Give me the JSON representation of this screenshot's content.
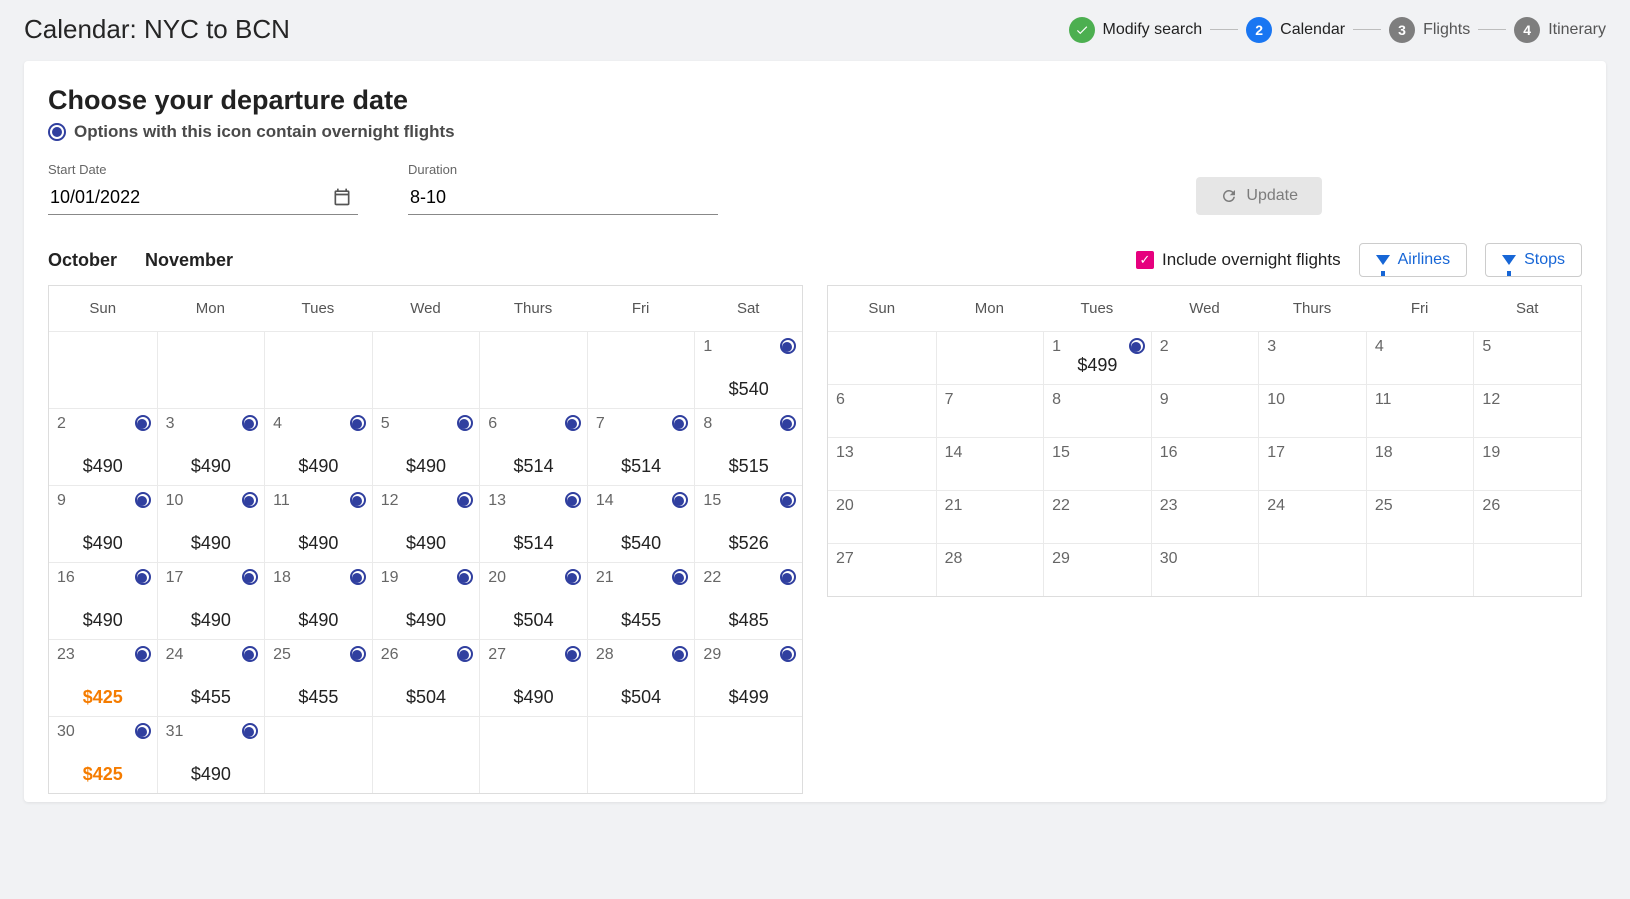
{
  "page_title": "Calendar: NYC to BCN",
  "stepper": {
    "modify": "Modify search",
    "calendar": {
      "num": "2",
      "label": "Calendar"
    },
    "flights": {
      "num": "3",
      "label": "Flights"
    },
    "itinerary": {
      "num": "4",
      "label": "Itinerary"
    }
  },
  "heading": "Choose your departure date",
  "overnight_note": "Options with this icon contain overnight flights",
  "start_date": {
    "label": "Start Date",
    "value": "10/01/2022"
  },
  "duration": {
    "label": "Duration",
    "value": "8-10"
  },
  "update_label": "Update",
  "tabs": {
    "october": "October",
    "november": "November"
  },
  "include_overnight": "Include overnight flights",
  "airlines_label": "Airlines",
  "stops_label": "Stops",
  "weekdays": [
    "Sun",
    "Mon",
    "Tues",
    "Wed",
    "Thurs",
    "Fri",
    "Sat"
  ],
  "october": [
    {
      "d": "",
      "p": "",
      "on": false
    },
    {
      "d": "",
      "p": "",
      "on": false
    },
    {
      "d": "",
      "p": "",
      "on": false
    },
    {
      "d": "",
      "p": "",
      "on": false
    },
    {
      "d": "",
      "p": "",
      "on": false
    },
    {
      "d": "",
      "p": "",
      "on": false
    },
    {
      "d": "1",
      "p": "$540",
      "on": true
    },
    {
      "d": "2",
      "p": "$490",
      "on": true
    },
    {
      "d": "3",
      "p": "$490",
      "on": true
    },
    {
      "d": "4",
      "p": "$490",
      "on": true
    },
    {
      "d": "5",
      "p": "$490",
      "on": true
    },
    {
      "d": "6",
      "p": "$514",
      "on": true
    },
    {
      "d": "7",
      "p": "$514",
      "on": true
    },
    {
      "d": "8",
      "p": "$515",
      "on": true
    },
    {
      "d": "9",
      "p": "$490",
      "on": true
    },
    {
      "d": "10",
      "p": "$490",
      "on": true
    },
    {
      "d": "11",
      "p": "$490",
      "on": true
    },
    {
      "d": "12",
      "p": "$490",
      "on": true
    },
    {
      "d": "13",
      "p": "$514",
      "on": true
    },
    {
      "d": "14",
      "p": "$540",
      "on": true
    },
    {
      "d": "15",
      "p": "$526",
      "on": true
    },
    {
      "d": "16",
      "p": "$490",
      "on": true
    },
    {
      "d": "17",
      "p": "$490",
      "on": true
    },
    {
      "d": "18",
      "p": "$490",
      "on": true
    },
    {
      "d": "19",
      "p": "$490",
      "on": true
    },
    {
      "d": "20",
      "p": "$504",
      "on": true
    },
    {
      "d": "21",
      "p": "$455",
      "on": true
    },
    {
      "d": "22",
      "p": "$485",
      "on": true
    },
    {
      "d": "23",
      "p": "$425",
      "on": true,
      "low": true
    },
    {
      "d": "24",
      "p": "$455",
      "on": true
    },
    {
      "d": "25",
      "p": "$455",
      "on": true
    },
    {
      "d": "26",
      "p": "$504",
      "on": true
    },
    {
      "d": "27",
      "p": "$490",
      "on": true
    },
    {
      "d": "28",
      "p": "$504",
      "on": true
    },
    {
      "d": "29",
      "p": "$499",
      "on": true
    },
    {
      "d": "30",
      "p": "$425",
      "on": true,
      "low": true
    },
    {
      "d": "31",
      "p": "$490",
      "on": true
    },
    {
      "d": "",
      "p": "",
      "on": false
    },
    {
      "d": "",
      "p": "",
      "on": false
    },
    {
      "d": "",
      "p": "",
      "on": false
    },
    {
      "d": "",
      "p": "",
      "on": false
    },
    {
      "d": "",
      "p": "",
      "on": false
    }
  ],
  "november": [
    {
      "d": "",
      "p": "",
      "on": false
    },
    {
      "d": "",
      "p": "",
      "on": false
    },
    {
      "d": "1",
      "p": "$499",
      "on": true
    },
    {
      "d": "2",
      "p": "",
      "on": false
    },
    {
      "d": "3",
      "p": "",
      "on": false
    },
    {
      "d": "4",
      "p": "",
      "on": false
    },
    {
      "d": "5",
      "p": "",
      "on": false
    },
    {
      "d": "6",
      "p": "",
      "on": false
    },
    {
      "d": "7",
      "p": "",
      "on": false
    },
    {
      "d": "8",
      "p": "",
      "on": false
    },
    {
      "d": "9",
      "p": "",
      "on": false
    },
    {
      "d": "10",
      "p": "",
      "on": false
    },
    {
      "d": "11",
      "p": "",
      "on": false
    },
    {
      "d": "12",
      "p": "",
      "on": false
    },
    {
      "d": "13",
      "p": "",
      "on": false
    },
    {
      "d": "14",
      "p": "",
      "on": false
    },
    {
      "d": "15",
      "p": "",
      "on": false
    },
    {
      "d": "16",
      "p": "",
      "on": false
    },
    {
      "d": "17",
      "p": "",
      "on": false
    },
    {
      "d": "18",
      "p": "",
      "on": false
    },
    {
      "d": "19",
      "p": "",
      "on": false
    },
    {
      "d": "20",
      "p": "",
      "on": false
    },
    {
      "d": "21",
      "p": "",
      "on": false
    },
    {
      "d": "22",
      "p": "",
      "on": false
    },
    {
      "d": "23",
      "p": "",
      "on": false
    },
    {
      "d": "24",
      "p": "",
      "on": false
    },
    {
      "d": "25",
      "p": "",
      "on": false
    },
    {
      "d": "26",
      "p": "",
      "on": false
    },
    {
      "d": "27",
      "p": "",
      "on": false
    },
    {
      "d": "28",
      "p": "",
      "on": false
    },
    {
      "d": "29",
      "p": "",
      "on": false
    },
    {
      "d": "30",
      "p": "",
      "on": false
    },
    {
      "d": "",
      "p": "",
      "on": false
    },
    {
      "d": "",
      "p": "",
      "on": false
    },
    {
      "d": "",
      "p": "",
      "on": false
    }
  ]
}
